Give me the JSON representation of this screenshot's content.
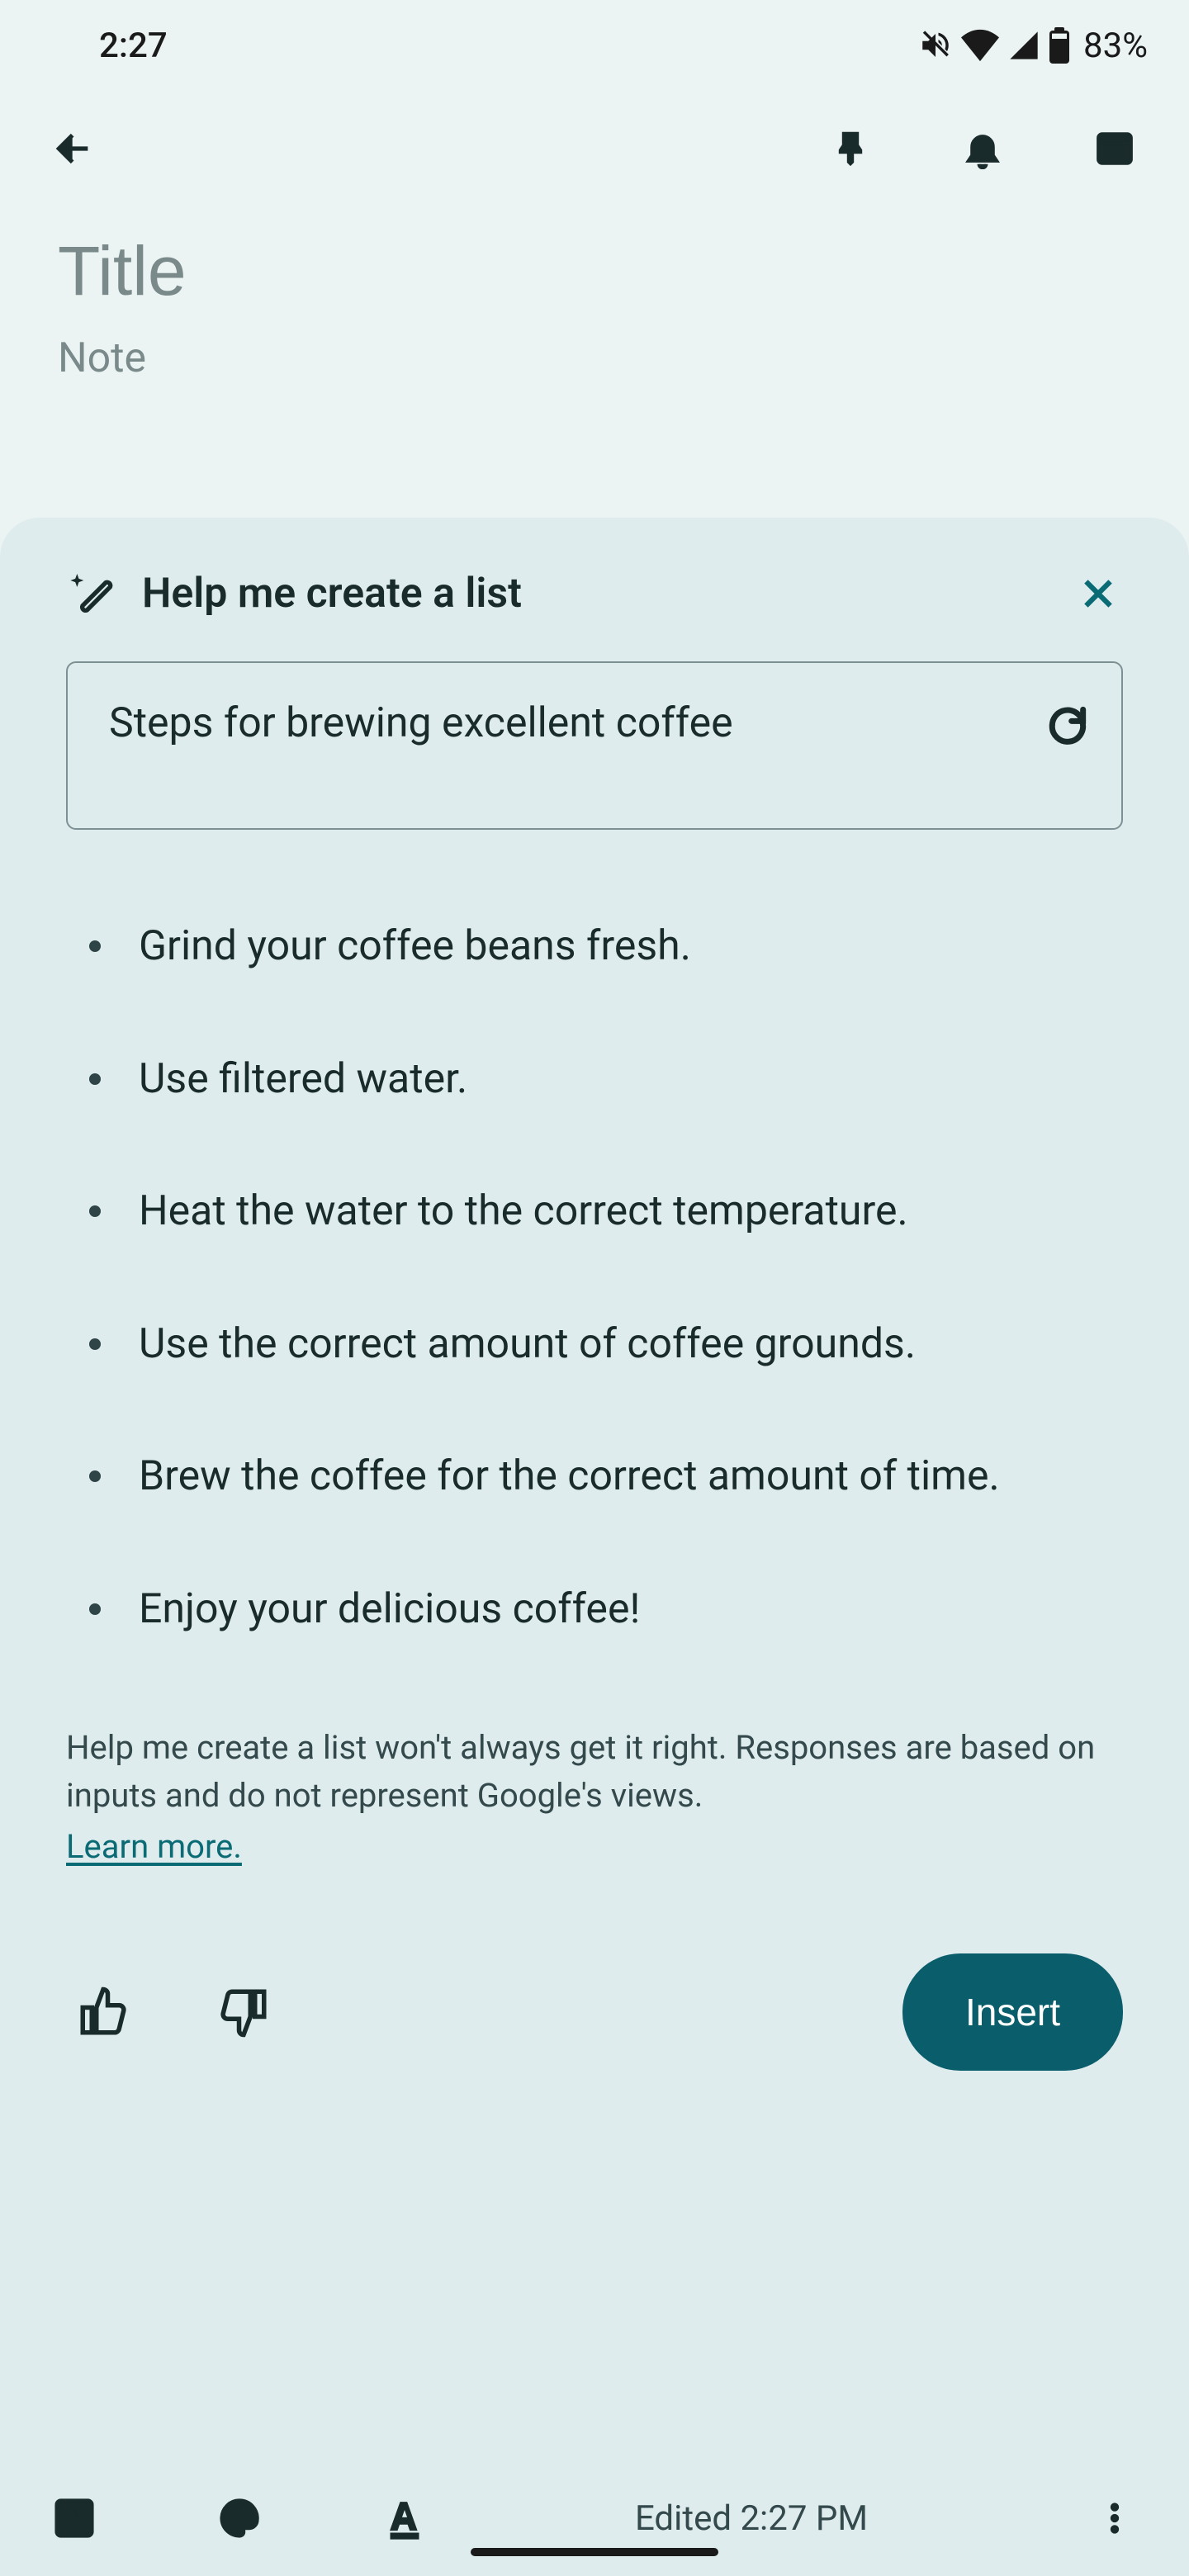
{
  "status": {
    "time": "2:27",
    "battery_pct": "83%"
  },
  "note": {
    "title_placeholder": "Title",
    "body_placeholder": "Note",
    "title_value": "",
    "body_value": ""
  },
  "assist": {
    "heading": "Help me create a list",
    "prompt": "Steps for brewing excellent coffee",
    "items": [
      "Grind your coffee beans fresh.",
      "Use filtered water.",
      "Heat the water to the correct temperature.",
      "Use the correct amount of coffee grounds.",
      "Brew the coffee for the correct amount of time.",
      "Enjoy your delicious coffee!"
    ],
    "disclaimer": "Help me create a list won't always get it right. Responses are based on inputs and do not represent Google's views.",
    "learn_more": "Learn more.",
    "insert_label": "Insert"
  },
  "footer": {
    "edited": "Edited 2:27 PM"
  }
}
